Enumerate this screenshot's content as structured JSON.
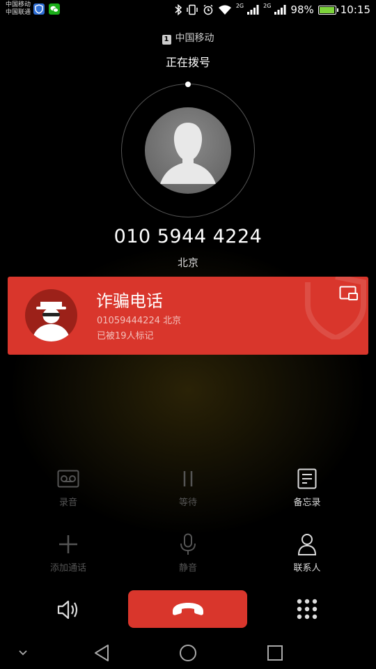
{
  "status_bar": {
    "carrier_1": "中国移动",
    "carrier_2": "中国联通",
    "network_1": "2G",
    "network_2": "2G",
    "battery": "98%",
    "battery_level": 0.98,
    "time": "10:15",
    "icons": [
      "shield-icon",
      "wechat-icon",
      "bluetooth-icon",
      "vibrate-icon",
      "alarm-icon",
      "wifi-icon",
      "signal-icon",
      "battery-icon"
    ]
  },
  "call": {
    "sim_label": "1",
    "sim_carrier": "中国移动",
    "status": "正在拨号",
    "number": "010 5944 4224",
    "location": "北京"
  },
  "fraud_card": {
    "title": "诈骗电话",
    "detail": "01059444224 北京",
    "marked": "已被19人标记",
    "color": "#d9362c"
  },
  "actions": [
    {
      "label": "录音",
      "icon": "record-icon",
      "enabled": false
    },
    {
      "label": "等待",
      "icon": "hold-icon",
      "enabled": false
    },
    {
      "label": "备忘录",
      "icon": "memo-icon",
      "enabled": true
    },
    {
      "label": "添加通话",
      "icon": "add-call-icon",
      "enabled": false
    },
    {
      "label": "静音",
      "icon": "mute-icon",
      "enabled": false
    },
    {
      "label": "联系人",
      "icon": "contacts-icon",
      "enabled": true
    }
  ],
  "bottom": {
    "end_call_icon": "hang-up-icon",
    "speaker_icon": "speaker-icon",
    "dialpad_icon": "dialpad-icon",
    "end_call_color": "#d9362c"
  },
  "nav": [
    "chevron-down-icon",
    "back-icon",
    "home-icon",
    "recents-icon"
  ]
}
